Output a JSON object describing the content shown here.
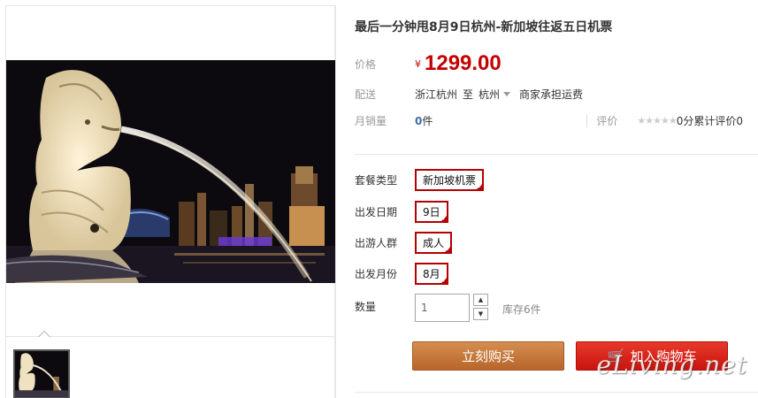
{
  "product": {
    "title": "最后一分钟甩8月9日杭州-新加坡往返五日机票"
  },
  "price": {
    "label": "价格",
    "currency": "¥",
    "value": "1299.00"
  },
  "shipping": {
    "label": "配送",
    "from": "浙江杭州",
    "to_word": "至",
    "to": "杭州",
    "note": "商家承担运费"
  },
  "sales": {
    "label": "月销量",
    "count": "0",
    "unit": "件",
    "rating_label": "评价",
    "stars": "★★★★★",
    "score": "0分",
    "total_label": "累计评价",
    "total": "0"
  },
  "options": [
    {
      "label": "套餐类型",
      "value": "新加坡机票"
    },
    {
      "label": "出发日期",
      "value": "9日"
    },
    {
      "label": "出游人群",
      "value": "成人"
    },
    {
      "label": "出发月份",
      "value": "8月"
    }
  ],
  "quantity": {
    "label": "数量",
    "value": "1",
    "stock": "库存6件"
  },
  "buttons": {
    "buy": "立刻购买",
    "cart": "加入购物车"
  },
  "watermark": "eLiving.net",
  "colors": {
    "price": "#c40000",
    "option_border": "#b30000",
    "buy_button": "#c4773a",
    "cart_button": "#d9231a"
  }
}
